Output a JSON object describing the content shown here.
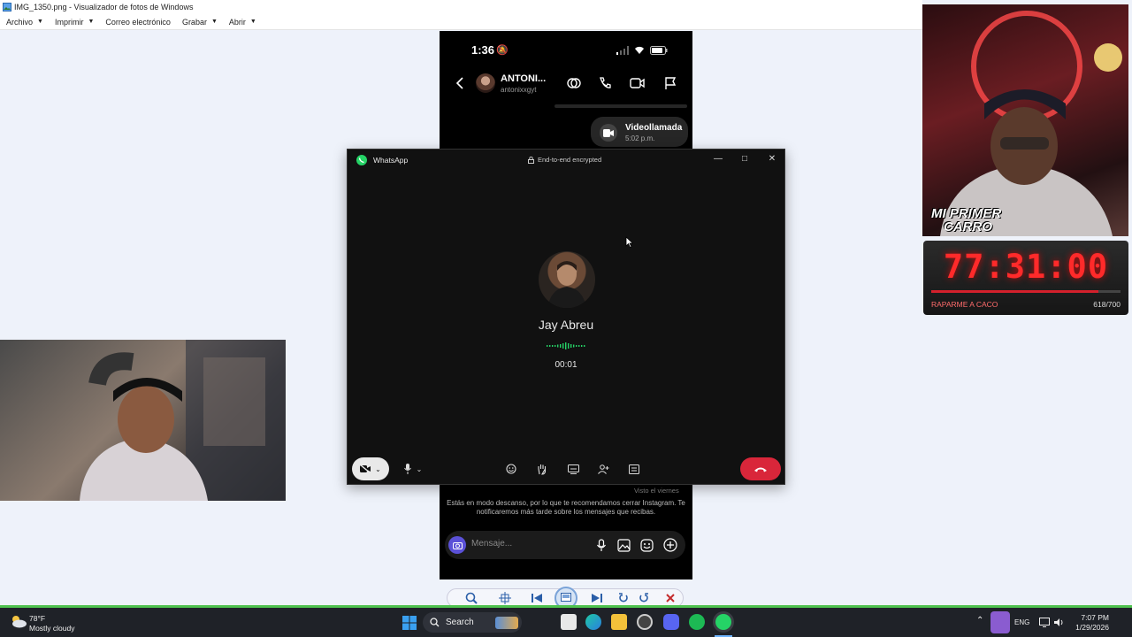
{
  "viewer": {
    "title": "IMG_1350.png - Visualizador de fotos de Windows",
    "menu": [
      "Archivo",
      "Imprimir",
      "Correo electrónico",
      "Grabar",
      "Abrir"
    ]
  },
  "phone": {
    "time": "1:36",
    "contact_name": "ANTONI...",
    "contact_user": "antonixxgyt",
    "video_call_title": "Videollamada",
    "video_call_time": "5:02 p.m.",
    "seen": "Visto el viernes",
    "rest_notice": "Estás en modo descanso, por lo que te recomendamos cerrar Instagram. Te notificaremos más tarde sobre los mensajes que recibas.",
    "message_placeholder": "Mensaje..."
  },
  "whatsapp": {
    "app_title": "WhatsApp",
    "encryption": "End-to-end encrypted",
    "caller_name": "Jay Abreu",
    "call_timer": "00:01"
  },
  "overlay": {
    "banner_top": "MI PRIMER",
    "banner_bottom": "CARRO",
    "counter_value": "77:31:00",
    "counter_label": "RAPARME A CACO",
    "counter_progress": "618/700",
    "progress_fraction": 0.883
  },
  "taskbar": {
    "temperature": "78°F",
    "condition": "Mostly cloudy",
    "search": "Search",
    "language": "ENG",
    "time": "7:07 PM",
    "date": "1/29/2026"
  },
  "colors": {
    "whatsapp_green": "#25d366",
    "end_call_red": "#d9263a",
    "counter_red": "#ff2a2a",
    "taskbar_bg": "#1f2228"
  }
}
